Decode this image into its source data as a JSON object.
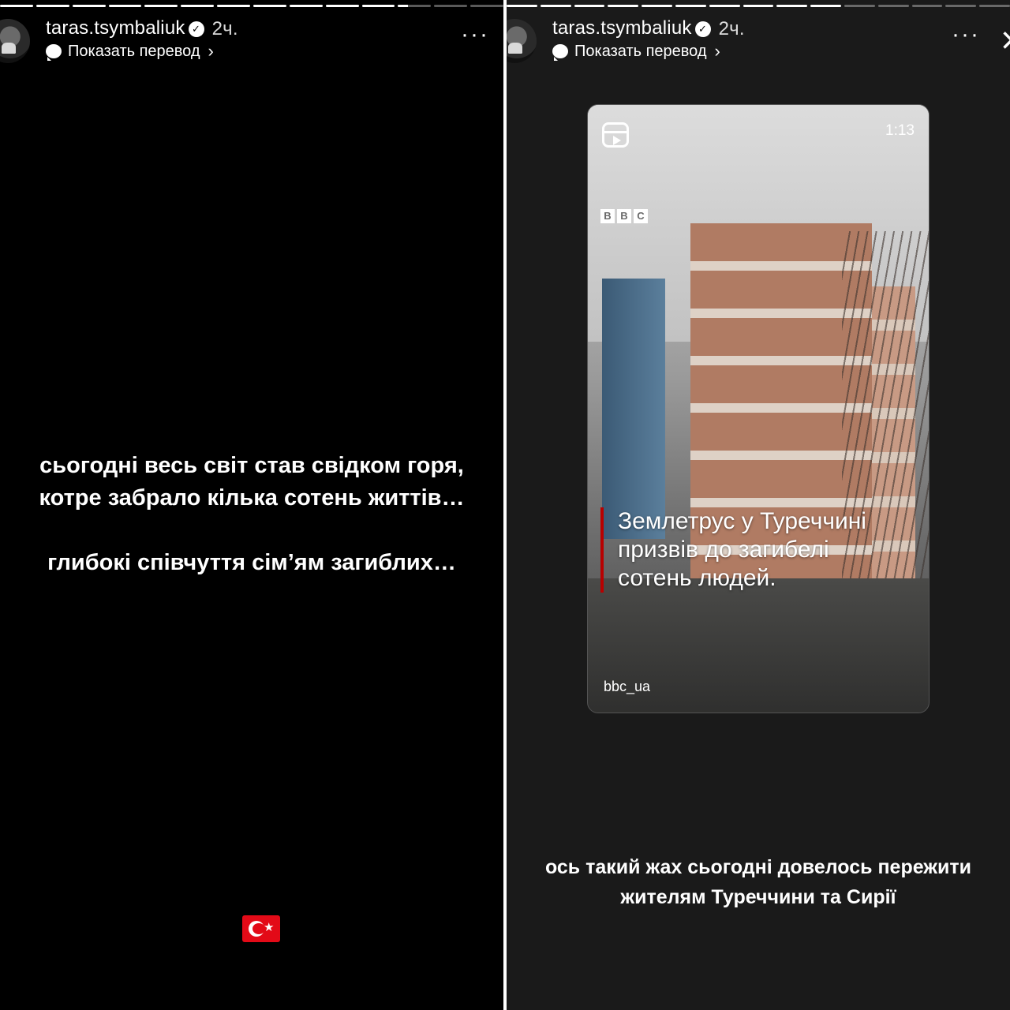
{
  "left_story": {
    "progress": [
      1,
      1,
      1,
      1,
      1,
      1,
      1,
      1,
      1,
      1,
      1,
      0.3,
      0,
      0
    ],
    "username": "taras.tsymbaliuk",
    "time": "2ч.",
    "translate_label": "Показать перевод",
    "message_lines": [
      "сьогодні весь світ став свідком горя,",
      "котре забрало кілька сотень життів…",
      "",
      "глибокі співчуття сім’ям загиблих…"
    ],
    "flag_emoji": "turkey-flag"
  },
  "right_story": {
    "progress": [
      1,
      1,
      1,
      1,
      1,
      1,
      1,
      1,
      1,
      1,
      0,
      0,
      0,
      0,
      0
    ],
    "username": "taras.tsymbaliuk",
    "time": "2ч.",
    "translate_label": "Показать перевод",
    "video": {
      "duration": "1:13",
      "logo": [
        "B",
        "B",
        "C"
      ],
      "headline_lines": [
        "Землетрус у Туреччині",
        "призвів до загибелі",
        "сотень людей."
      ],
      "source": "bbc_ua"
    },
    "caption_lines": [
      "ось такий жах сьогодні довелось пережити",
      "жителям Туреччини та Сирії"
    ]
  },
  "colors": {
    "left_bg": "#000000",
    "right_bg": "#1a1a1a",
    "headline_bar": "#b80000",
    "flag_red": "#e30a17"
  }
}
